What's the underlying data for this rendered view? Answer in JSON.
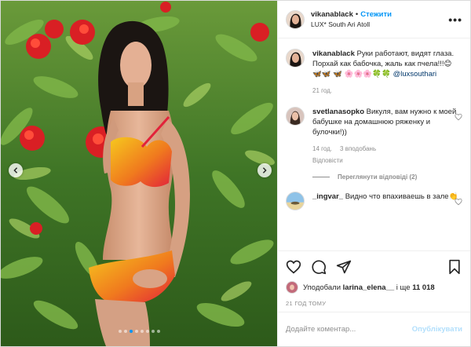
{
  "colors": {
    "accent": "#0095f6",
    "text": "#262626",
    "secondary": "#8e8e8e",
    "publish_disabled": "#b2dffc"
  },
  "photo": {
    "carousel_total": 8,
    "carousel_active": 3,
    "icons": {
      "prev": "chevron-left-icon",
      "next": "chevron-right-icon"
    }
  },
  "header": {
    "username": "vikanablack",
    "separator": "•",
    "follow_label": "Стежити",
    "location": "LUX* South Ari Atoll",
    "more_label": "•••"
  },
  "caption": {
    "username": "vikanablack",
    "text": "Руки работают, видят глаза. Порхай как бабочка, жаль как пчела!!!😊 🦋🦋 🦋 🌸🌸🌸🍀🍀",
    "mention": "@luxsouthari",
    "time": "21 год."
  },
  "comments": [
    {
      "username": "svetlanasopko",
      "text": "Викуля, вам нужно к моей бабушке на домашнюю ряженку и булочки!))",
      "time": "14 год.",
      "likes": "3 вподобань",
      "reply_label": "Відповісти",
      "replies_toggle": "Переглянути відповіді (2)"
    },
    {
      "username": "_ingvar_",
      "text": "Видно что впахиваешь в зале👏"
    }
  ],
  "actions": {
    "icons": [
      "heart-icon",
      "comment-icon",
      "share-icon",
      "bookmark-icon"
    ]
  },
  "likes": {
    "prefix": "Уподобали",
    "user": "larina_elena__",
    "middle": "і ще",
    "count": "11 018"
  },
  "timestamp": "21 ГОД ТОМУ",
  "add_comment": {
    "placeholder": "Додайте коментар...",
    "publish_label": "Опублікувати"
  }
}
